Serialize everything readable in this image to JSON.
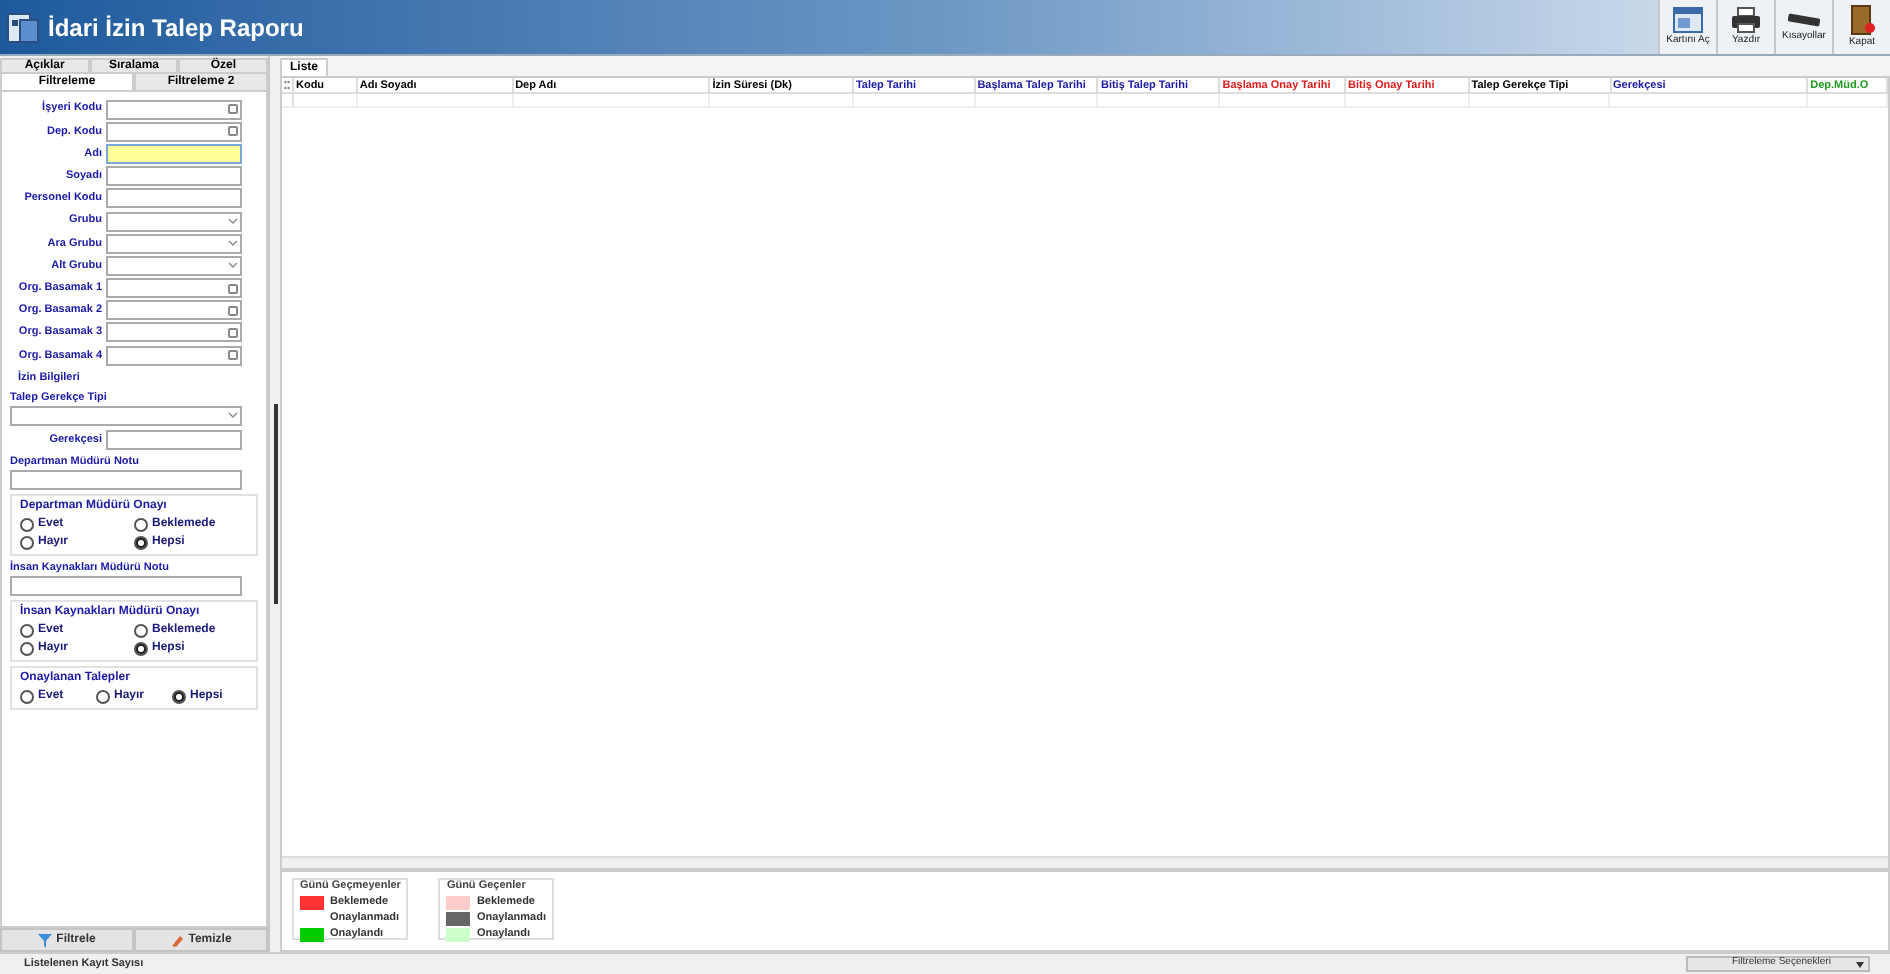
{
  "window": {
    "title": "İdari İzin Talep Raporu"
  },
  "toolbar": [
    {
      "label": "Kartını Aç",
      "kind": "card"
    },
    {
      "label": "Yazdır",
      "kind": "printer"
    },
    {
      "label": "Kısayollar",
      "kind": "keyboard"
    },
    {
      "label": "Kapat",
      "kind": "door"
    }
  ],
  "left_tabs": {
    "row_1": [
      {
        "label": "Açıklar",
        "selected": false
      },
      {
        "label": "Sıralama",
        "selected": false
      },
      {
        "label": "Özel",
        "selected": false
      }
    ],
    "row_2": [
      {
        "label": "Filtreleme",
        "selected": true
      },
      {
        "label": "Filtreleme 2",
        "selected": false
      }
    ]
  },
  "filters": [
    {
      "label": "İşyeri Kodu",
      "kind": "lookup",
      "focused": false
    },
    {
      "label": "Dep. Kodu",
      "kind": "lookup",
      "focused": false
    },
    {
      "label": "Adı",
      "kind": "text",
      "focused": true
    },
    {
      "label": "Soyadı",
      "kind": "text",
      "focused": false
    },
    {
      "label": "Personel Kodu",
      "kind": "text",
      "focused": false
    },
    {
      "label": "Grubu",
      "kind": "dropdown",
      "focused": false
    },
    {
      "label": "Ara Grubu",
      "kind": "dropdown",
      "focused": false
    },
    {
      "label": "Alt Grubu",
      "kind": "dropdown",
      "focused": false
    },
    {
      "label": "Org. Basamak 1",
      "kind": "lookup",
      "focused": false
    },
    {
      "label": "Org. Basamak 2",
      "kind": "lookup",
      "focused": false
    },
    {
      "label": "Org. Basamak 3",
      "kind": "lookup",
      "focused": false
    },
    {
      "label": "Org. Basamak 4",
      "kind": "lookup",
      "focused": false
    }
  ],
  "leave_info": {
    "title": "İzin Bilgileri",
    "reason_type_label": "Talep Gerekçe Tipi",
    "reason_label": "Gerekçesi",
    "dept_note_label": "Departman Müdürü Notu",
    "dept_approval": {
      "title": "Departman Müdürü Onayı",
      "options": [
        {
          "label": "Evet",
          "selected": false
        },
        {
          "label": "Beklemede",
          "selected": false
        },
        {
          "label": "Hayır",
          "selected": false
        },
        {
          "label": "Hepsi",
          "selected": true
        }
      ]
    },
    "hr_note_label": "İnsan Kaynakları Müdürü Notu",
    "hr_approval": {
      "title": "İnsan Kaynakları Müdürü Onayı",
      "options": [
        {
          "label": "Evet",
          "selected": false
        },
        {
          "label": "Beklemede",
          "selected": false
        },
        {
          "label": "Hayır",
          "selected": false
        },
        {
          "label": "Hepsi",
          "selected": true
        }
      ]
    },
    "approved": {
      "title": "Onaylanan Talepler",
      "options": [
        {
          "label": "Evet",
          "selected": false
        },
        {
          "label": "Hayır",
          "selected": false
        },
        {
          "label": "Hepsi",
          "selected": true
        }
      ]
    }
  },
  "left_buttons": [
    {
      "label": "Filtrele",
      "kind": "filter"
    },
    {
      "label": "Temizle",
      "kind": "eraser"
    }
  ],
  "right_tabs": [
    {
      "label": "Liste",
      "selected": true
    }
  ],
  "table": {
    "columns": [
      {
        "label": "Kodu",
        "color": "#000000"
      },
      {
        "label": "Adı Soyadı",
        "color": "#000000"
      },
      {
        "label": "Dep Adı",
        "color": "#000000"
      },
      {
        "label": "İzin Süresi (Dk)",
        "color": "#000000"
      },
      {
        "label": "Talep Tarihi",
        "color": "#1a1aa6"
      },
      {
        "label": "Başlama Talep Tarihi",
        "color": "#1a1aa6"
      },
      {
        "label": "Bitiş Talep Tarihi",
        "color": "#1a1aa6"
      },
      {
        "label": "Başlama Onay Tarihi",
        "color": "#e01b1b"
      },
      {
        "label": "Bitiş Onay Tarihi",
        "color": "#e01b1b"
      },
      {
        "label": "Talep Gerekçe Tipi",
        "color": "#000000"
      },
      {
        "label": "Gerekçesi",
        "color": "#1a1aa6"
      },
      {
        "label": "Dep.Müd.O",
        "color": "#1f9a1f"
      }
    ]
  },
  "legends": [
    {
      "title": "Günü Geçmeyenler",
      "items": [
        {
          "label": "Beklemede",
          "color": "#ff3333"
        },
        {
          "label": "Onaylanmadı"
        },
        {
          "label": "Onaylandı",
          "color": "#00cc00"
        }
      ]
    },
    {
      "title": "Günü Geçenler",
      "items": [
        {
          "label": "Beklemede",
          "color": "#ffcccc"
        },
        {
          "label": "Onaylanmadı",
          "color": "#666666"
        },
        {
          "label": "Onaylandı",
          "color": "#ccffcc"
        }
      ]
    }
  ],
  "status_bar": {
    "record_count_label": "Listelenen Kayıt Sayısı",
    "filter_options": "Filtreleme Seçenekleri"
  }
}
